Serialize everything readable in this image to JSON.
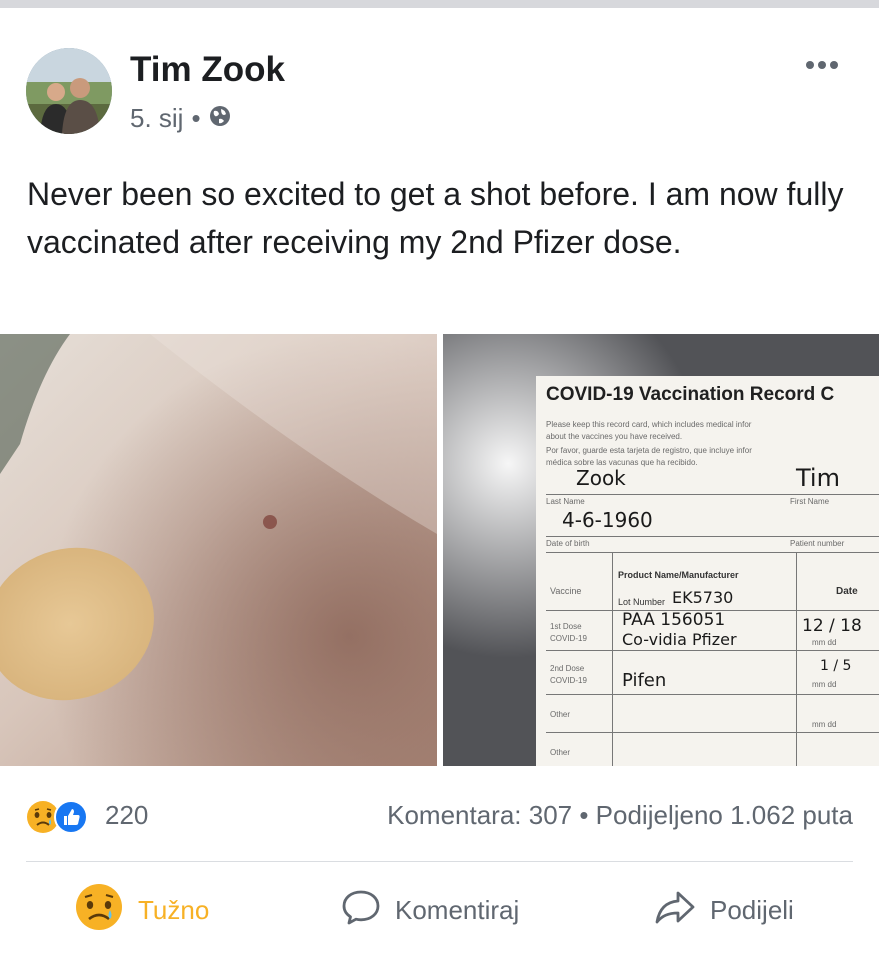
{
  "post": {
    "author": "Tim Zook",
    "date": "5. sij",
    "separator": "•",
    "text": "Never been so excited to get a shot before. I am now fully vaccinated after receiving my 2nd Pfizer dose."
  },
  "card": {
    "title": "COVID-19 Vaccination Record C",
    "note_en": "Please keep this record card, which includes medical infor",
    "note_en2": "about the vaccines you have received.",
    "note_es": "Por favor, guarde esta tarjeta de registro, que incluye infor",
    "note_es2": "médica sobre las vacunas que ha recibido.",
    "last_name_value": "Zook",
    "first_name_value": "Tim",
    "last_name_label": "Last Name",
    "first_name_label": "First Name",
    "dob_value": "4-6-1960",
    "dob_label": "Date of birth",
    "patient_label": "Patient number",
    "col_vaccine": "Vaccine",
    "col_product": "Product Name/Manufacturer",
    "col_lot": "Lot Number",
    "col_date": "Date",
    "lot_value": "EK5730",
    "dose1_label": "1st Dose",
    "dose1_sub": "COVID-19",
    "dose1_line1": "PAA 156051",
    "dose1_line2": "Co-vidia Pfizer",
    "dose1_date": "12 / 18",
    "dose2_label": "2nd Dose",
    "dose2_sub": "COVID-19",
    "dose2_value": "Pifen",
    "dose2_date": "1 / 5",
    "mmdd": "mm   dd",
    "other1": "Other",
    "other2": "Other"
  },
  "stats": {
    "reaction_count": "220",
    "comments_shares": "Komentara: 307 • Podijeljeno 1.062 puta"
  },
  "actions": {
    "react": "Tužno",
    "comment": "Komentiraj",
    "share": "Podijeli"
  },
  "colors": {
    "sad_reaction": "#f7b125",
    "like_blue": "#1877f2",
    "secondary_text": "#606770"
  }
}
